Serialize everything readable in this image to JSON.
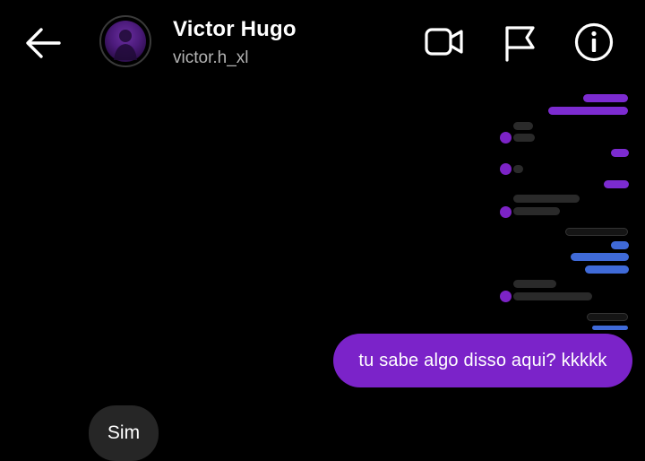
{
  "header": {
    "back_icon": "arrow-left-icon",
    "name": "Victor Hugo",
    "username": "victor.h_xl",
    "video_icon": "video-camera-icon",
    "flag_icon": "flag-icon",
    "info_icon": "info-icon"
  },
  "colors": {
    "background": "#000000",
    "sent_bubble": "#7b23c9",
    "received_bubble": "#262626",
    "secondary_text": "#b3b3b3"
  },
  "messages": [
    {
      "type": "image",
      "from": "me",
      "description_icon": "shared-screenshot-image"
    },
    {
      "type": "text",
      "from": "me",
      "text": "tu sabe algo disso aqui? kkkkk"
    },
    {
      "type": "text",
      "from": "them",
      "text": "Sim"
    }
  ]
}
